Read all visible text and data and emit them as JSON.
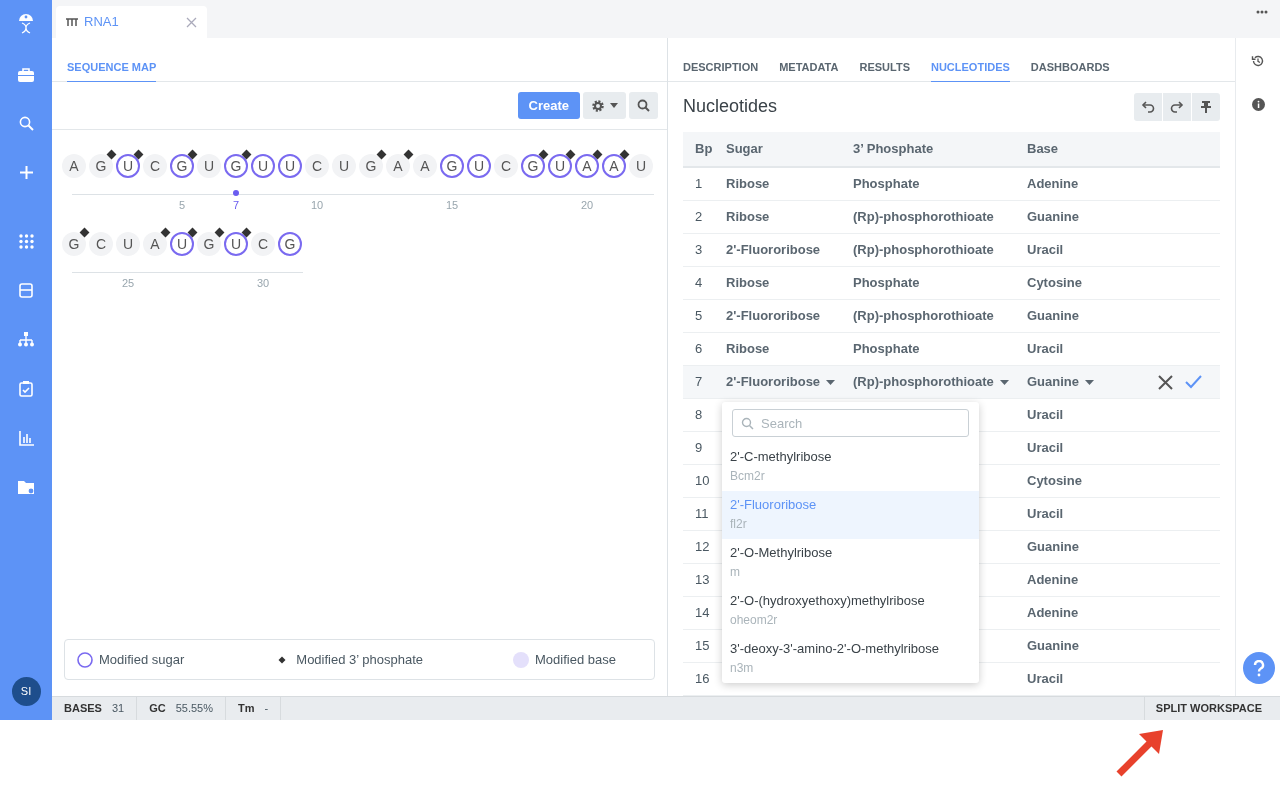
{
  "document_tab": {
    "label": "RNA1"
  },
  "view_tabs": [
    {
      "label": "SEQUENCE MAP",
      "selected": true
    }
  ],
  "detail_tabs": [
    {
      "label": "DESCRIPTION",
      "selected": false
    },
    {
      "label": "METADATA",
      "selected": false
    },
    {
      "label": "RESULTS",
      "selected": false
    },
    {
      "label": "NUCLEOTIDES",
      "selected": true
    },
    {
      "label": "DASHBOARDS",
      "selected": false
    }
  ],
  "toolbar": {
    "create": "Create"
  },
  "sequence_rows": [
    [
      {
        "letter": "A",
        "modified_sugar": false,
        "modified_phosphate": false,
        "selected": false
      },
      {
        "letter": "G",
        "modified_sugar": false,
        "modified_phosphate": true,
        "selected": false
      },
      {
        "letter": "U",
        "modified_sugar": true,
        "modified_phosphate": true,
        "selected": false
      },
      {
        "letter": "C",
        "modified_sugar": false,
        "modified_phosphate": false,
        "selected": false
      },
      {
        "letter": "G",
        "modified_sugar": true,
        "modified_phosphate": true,
        "selected": false,
        "tick": "5"
      },
      {
        "letter": "U",
        "modified_sugar": false,
        "modified_phosphate": false,
        "selected": false
      },
      {
        "letter": "G",
        "modified_sugar": true,
        "modified_phosphate": true,
        "selected": true,
        "tick": "7"
      },
      {
        "letter": "U",
        "modified_sugar": true,
        "modified_phosphate": false,
        "selected": false
      },
      {
        "letter": "U",
        "modified_sugar": true,
        "modified_phosphate": false,
        "selected": false
      },
      {
        "letter": "C",
        "modified_sugar": false,
        "modified_phosphate": false,
        "selected": false,
        "tick": "10"
      },
      {
        "letter": "U",
        "modified_sugar": false,
        "modified_phosphate": false,
        "selected": false
      },
      {
        "letter": "G",
        "modified_sugar": false,
        "modified_phosphate": true,
        "selected": false
      },
      {
        "letter": "A",
        "modified_sugar": false,
        "modified_phosphate": true,
        "selected": false
      },
      {
        "letter": "A",
        "modified_sugar": false,
        "modified_phosphate": false,
        "selected": false
      },
      {
        "letter": "G",
        "modified_sugar": true,
        "modified_phosphate": false,
        "selected": false,
        "tick": "15"
      },
      {
        "letter": "U",
        "modified_sugar": true,
        "modified_phosphate": false,
        "selected": false
      },
      {
        "letter": "C",
        "modified_sugar": false,
        "modified_phosphate": false,
        "selected": false
      },
      {
        "letter": "G",
        "modified_sugar": true,
        "modified_phosphate": true,
        "selected": false
      },
      {
        "letter": "U",
        "modified_sugar": true,
        "modified_phosphate": true,
        "selected": false
      },
      {
        "letter": "A",
        "modified_sugar": true,
        "modified_phosphate": true,
        "selected": false,
        "tick": "20"
      },
      {
        "letter": "A",
        "modified_sugar": true,
        "modified_phosphate": true,
        "selected": false
      },
      {
        "letter": "U",
        "modified_sugar": false,
        "modified_phosphate": false,
        "selected": false
      }
    ],
    [
      {
        "letter": "G",
        "modified_sugar": false,
        "modified_phosphate": true,
        "selected": false
      },
      {
        "letter": "C",
        "modified_sugar": false,
        "modified_phosphate": false,
        "selected": false
      },
      {
        "letter": "U",
        "modified_sugar": false,
        "modified_phosphate": false,
        "selected": false,
        "tick": "25"
      },
      {
        "letter": "A",
        "modified_sugar": false,
        "modified_phosphate": true,
        "selected": false
      },
      {
        "letter": "U",
        "modified_sugar": true,
        "modified_phosphate": true,
        "selected": false
      },
      {
        "letter": "G",
        "modified_sugar": false,
        "modified_phosphate": true,
        "selected": false
      },
      {
        "letter": "U",
        "modified_sugar": true,
        "modified_phosphate": true,
        "selected": false
      },
      {
        "letter": "C",
        "modified_sugar": false,
        "modified_phosphate": false,
        "selected": false,
        "tick": "30"
      },
      {
        "letter": "G",
        "modified_sugar": true,
        "modified_phosphate": false,
        "selected": false
      }
    ]
  ],
  "legend": [
    {
      "kind": "sugar",
      "label": "Modified sugar"
    },
    {
      "kind": "phosphate",
      "label": "Modified 3’ phosphate"
    },
    {
      "kind": "base",
      "label": "Modified base"
    }
  ],
  "nucleotides": {
    "title": "Nucleotides",
    "columns": [
      "Bp",
      "Sugar",
      "3’ Phosphate",
      "Base"
    ],
    "rows": [
      {
        "bp": "1",
        "sugar": "Ribose",
        "phosphate": "Phosphate",
        "base": "Adenine",
        "editing": false
      },
      {
        "bp": "2",
        "sugar": "Ribose",
        "phosphate": "(Rp)-phosphorothioate",
        "base": "Guanine",
        "editing": false
      },
      {
        "bp": "3",
        "sugar": "2'-Fluororibose",
        "phosphate": "(Rp)-phosphorothioate",
        "base": "Uracil",
        "editing": false
      },
      {
        "bp": "4",
        "sugar": "Ribose",
        "phosphate": "Phosphate",
        "base": "Cytosine",
        "editing": false
      },
      {
        "bp": "5",
        "sugar": "2'-Fluororibose",
        "phosphate": "(Rp)-phosphorothioate",
        "base": "Guanine",
        "editing": false
      },
      {
        "bp": "6",
        "sugar": "Ribose",
        "phosphate": "Phosphate",
        "base": "Uracil",
        "editing": false
      },
      {
        "bp": "7",
        "sugar": "2'-Fluororibose",
        "phosphate": "(Rp)-phosphorothioate",
        "base": "Guanine",
        "editing": true
      },
      {
        "bp": "8",
        "base": "Uracil",
        "editing": false
      },
      {
        "bp": "9",
        "base": "Uracil",
        "editing": false
      },
      {
        "bp": "10",
        "base": "Cytosine",
        "editing": false
      },
      {
        "bp": "11",
        "base": "Uracil",
        "editing": false
      },
      {
        "bp": "12",
        "base": "Guanine",
        "editing": false
      },
      {
        "bp": "13",
        "base": "Adenine",
        "editing": false
      },
      {
        "bp": "14",
        "base": "Adenine",
        "editing": false
      },
      {
        "bp": "15",
        "base": "Guanine",
        "editing": false
      },
      {
        "bp": "16",
        "base": "Uracil",
        "editing": false
      }
    ]
  },
  "dropdown": {
    "placeholder": "Search",
    "options": [
      {
        "name": "2'-C-methylribose",
        "code": "Bcm2r",
        "selected": false
      },
      {
        "name": "2'-Fluororibose",
        "code": "fl2r",
        "selected": true
      },
      {
        "name": "2'-O-Methylribose",
        "code": "m",
        "selected": false
      },
      {
        "name": "2'-O-(hydroxyethoxy)methylribose",
        "code": "oheom2r",
        "selected": false
      },
      {
        "name": "3'-deoxy-3'-amino-2'-O-methylribose",
        "code": "n3m",
        "selected": false
      }
    ]
  },
  "status_bar": {
    "items": [
      {
        "label": "BASES",
        "value": "31"
      },
      {
        "label": "GC",
        "value": "55.55%"
      },
      {
        "label": "Tm",
        "value": "-"
      }
    ],
    "button": "SPLIT WORKSPACE"
  },
  "user": {
    "initials": "SI"
  }
}
